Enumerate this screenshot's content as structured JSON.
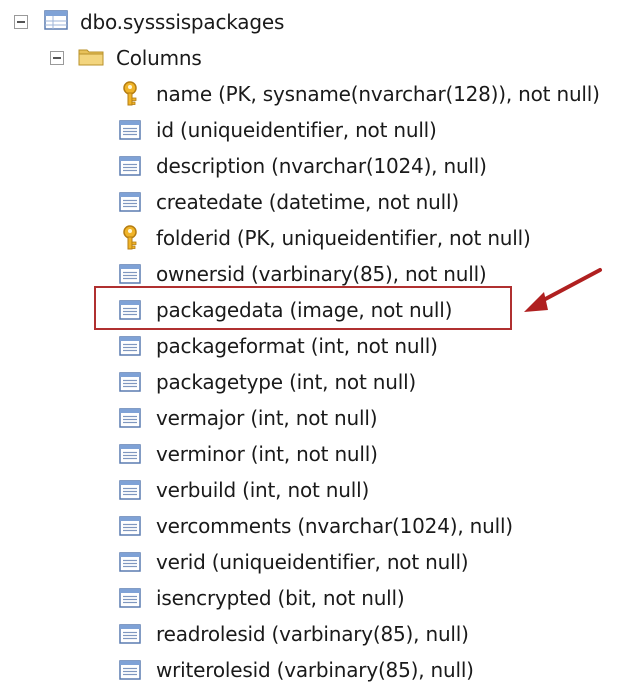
{
  "tree": {
    "table_label": "dbo.sysssispackages",
    "folder_label": "Columns",
    "columns": [
      {
        "label": "name (PK, sysname(nvarchar(128)), not null)",
        "icon": "key-icon"
      },
      {
        "label": "id (uniqueidentifier, not null)",
        "icon": "column-icon"
      },
      {
        "label": "description (nvarchar(1024), null)",
        "icon": "column-icon"
      },
      {
        "label": "createdate (datetime, not null)",
        "icon": "column-icon"
      },
      {
        "label": "folderid (PK, uniqueidentifier, not null)",
        "icon": "key-icon"
      },
      {
        "label": "ownersid (varbinary(85), not null)",
        "icon": "column-icon"
      },
      {
        "label": "packagedata (image, not null)",
        "icon": "column-icon",
        "highlighted": true
      },
      {
        "label": "packageformat (int, not null)",
        "icon": "column-icon"
      },
      {
        "label": "packagetype (int, not null)",
        "icon": "column-icon"
      },
      {
        "label": "vermajor (int, not null)",
        "icon": "column-icon"
      },
      {
        "label": "verminor (int, not null)",
        "icon": "column-icon"
      },
      {
        "label": "verbuild (int, not null)",
        "icon": "column-icon"
      },
      {
        "label": "vercomments (nvarchar(1024), null)",
        "icon": "column-icon"
      },
      {
        "label": "verid (uniqueidentifier, not null)",
        "icon": "column-icon"
      },
      {
        "label": "isencrypted (bit, not null)",
        "icon": "column-icon"
      },
      {
        "label": "readrolesid (varbinary(85), null)",
        "icon": "column-icon"
      },
      {
        "label": "writerolesid (varbinary(85), null)",
        "icon": "column-icon"
      }
    ]
  },
  "colors": {
    "highlight_box": "#b03030",
    "arrow": "#b02020",
    "key": "#e0a020",
    "column_icon_border": "#5a7bb0",
    "folder": "#e8c15a"
  }
}
